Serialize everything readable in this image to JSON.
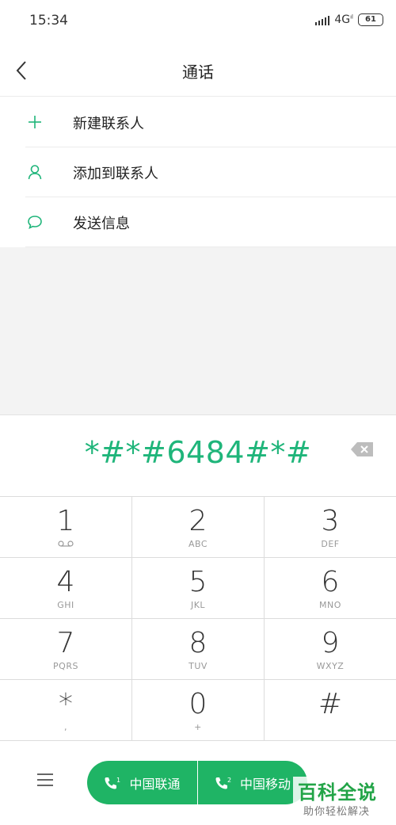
{
  "status": {
    "time": "15:34",
    "network": "4G",
    "battery": "61"
  },
  "header": {
    "title": "通话"
  },
  "menu": [
    {
      "label": "新建联系人",
      "icon": "plus-icon"
    },
    {
      "label": "添加到联系人",
      "icon": "person-icon"
    },
    {
      "label": "发送信息",
      "icon": "message-bubble-icon"
    }
  ],
  "dialer": {
    "number": "*#*#6484#*#"
  },
  "keypad": [
    [
      {
        "digit": "1",
        "sub": ""
      },
      {
        "digit": "2",
        "sub": "ABC"
      },
      {
        "digit": "3",
        "sub": "DEF"
      }
    ],
    [
      {
        "digit": "4",
        "sub": "GHI"
      },
      {
        "digit": "5",
        "sub": "JKL"
      },
      {
        "digit": "6",
        "sub": "MNO"
      }
    ],
    [
      {
        "digit": "7",
        "sub": "PQRS"
      },
      {
        "digit": "8",
        "sub": "TUV"
      },
      {
        "digit": "9",
        "sub": "WXYZ"
      }
    ],
    [
      {
        "digit": "*",
        "sub": ","
      },
      {
        "digit": "0",
        "sub": "+"
      },
      {
        "digit": "#",
        "sub": ""
      }
    ]
  ],
  "call_buttons": {
    "sim1_label": "中国联通",
    "sim2_label": "中国移动"
  },
  "watermark": {
    "main": "百科全说",
    "sub": "助你轻松解决"
  },
  "colors": {
    "accent": "#1fb57a",
    "call_button": "#1fb465",
    "watermark": "#22a447"
  }
}
